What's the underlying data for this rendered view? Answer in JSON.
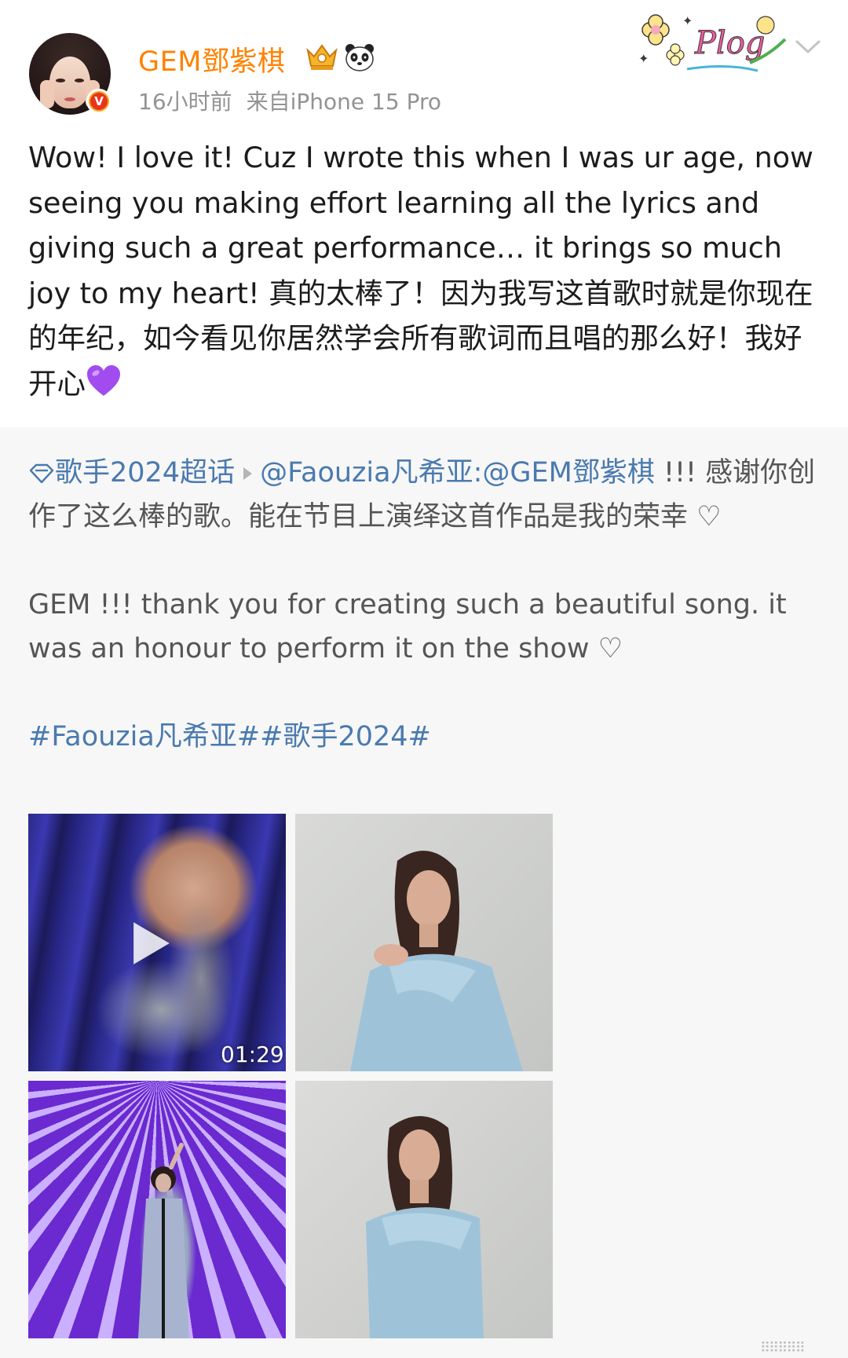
{
  "header": {
    "username": "GEM鄧紫棋",
    "time": "16小时前",
    "source": "来自iPhone 15 Pro",
    "badge_text": "Plog",
    "badge_icon": "plog-flower-badge",
    "verified_mark": "V"
  },
  "post": {
    "text": "Wow! I love it! Cuz I wrote this when I was ur age, now seeing you making effort learning all the lyrics and giving such a great performance… it brings so much joy to my heart! 真的太棒了！因为我写这首歌时就是你现在的年纪，如今看见你居然学会所有歌词而且唱的那么好！我好开心",
    "emoji": "purple-heart"
  },
  "repost": {
    "topic": "歌手2024超话",
    "author": "@Faouzia凡希亚",
    "mention": "@GEM鄧紫棋",
    "text_cn": " !!! 感谢你创作了这么棒的歌。能在节目上演绎这首作品是我的荣幸 ♡",
    "text_en": "GEM !!! thank you for creating such a beautiful song. it was an honour to perform it on the show ♡",
    "hashtags": "#Faouzia凡希亚##歌手2024#",
    "media": [
      {
        "type": "video",
        "duration": "01:29",
        "alt": "performer singing on purple stage"
      },
      {
        "type": "image",
        "alt": "woman in light blue off-shoulder dress"
      },
      {
        "type": "image",
        "alt": "singer on stage with purple light beams"
      },
      {
        "type": "image",
        "alt": "woman in light blue dress posing"
      }
    ]
  },
  "footer": {
    "watermark": "⠿⠿⠿⠿⠿"
  },
  "colors": {
    "username": "#ff8200",
    "link": "#4a7aaf",
    "meta": "#939393",
    "repost_bg": "#f7f7f7"
  }
}
